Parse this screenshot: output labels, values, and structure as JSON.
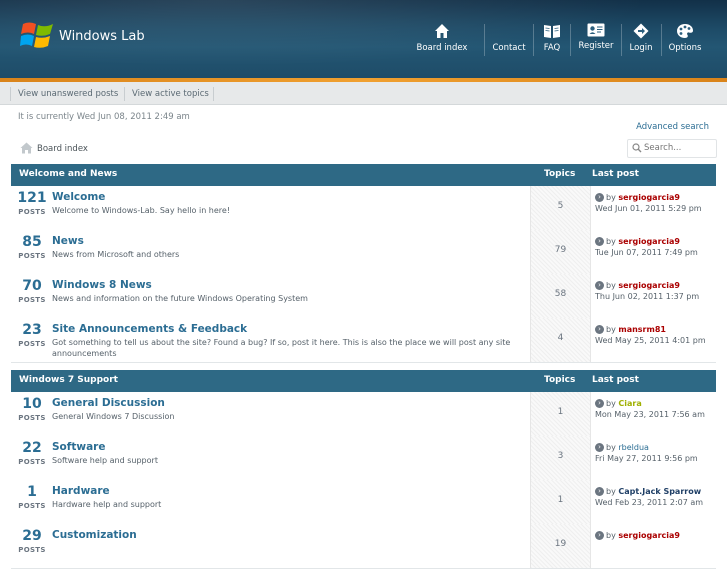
{
  "header": {
    "logo_text": "Windows Lab",
    "nav": [
      {
        "label": "Board index",
        "icon": "home-icon"
      },
      {
        "label": "Contact",
        "icon": "contact-icon"
      },
      {
        "label": "FAQ",
        "icon": "book-icon"
      },
      {
        "label": "Register",
        "icon": "register-icon"
      },
      {
        "label": "Login",
        "icon": "login-icon"
      },
      {
        "label": "Options",
        "icon": "palette-icon"
      }
    ],
    "colors": {
      "header": "#1d4a66",
      "accent": "#f0a030"
    }
  },
  "subnav": {
    "unanswered": "View unanswered posts",
    "active": "View active topics"
  },
  "meta": {
    "date_line": "It is currently Wed Jun 08, 2011 2:49 am",
    "advanced_search": "Advanced search",
    "breadcrumb": "Board index",
    "search_placeholder": "Search..."
  },
  "categories": [
    {
      "title": "Welcome and News",
      "topics_header": "Topics",
      "last_post_header": "Last post",
      "forums": [
        {
          "posts": "121",
          "posts_label": "POSTS",
          "name": "Welcome",
          "desc": "Welcome to Windows-Lab. Say hello in here!",
          "topics": "5",
          "by": "by",
          "user": "sergiogarcia9",
          "user_color": "#aa0000",
          "date": "Wed Jun 01, 2011 5:29 pm"
        },
        {
          "posts": "85",
          "posts_label": "POSTS",
          "name": "News",
          "desc": "News from Microsoft and others",
          "topics": "79",
          "by": "by",
          "user": "sergiogarcia9",
          "user_color": "#aa0000",
          "date": "Tue Jun 07, 2011 7:49 pm"
        },
        {
          "posts": "70",
          "posts_label": "POSTS",
          "name": "Windows 8 News",
          "desc": "News and information on the future Windows Operating System",
          "topics": "58",
          "by": "by",
          "user": "sergiogarcia9",
          "user_color": "#aa0000",
          "date": "Thu Jun 02, 2011 1:37 pm"
        },
        {
          "posts": "23",
          "posts_label": "POSTS",
          "name": "Site Announcements & Feedback",
          "desc": "Got something to tell us about the site? Found a bug? If so, post it here. This is also the place we will post any site announcements",
          "topics": "4",
          "by": "by",
          "user": "mansrm81",
          "user_color": "#aa0000",
          "date": "Wed May 25, 2011 4:01 pm"
        }
      ]
    },
    {
      "title": "Windows 7 Support",
      "topics_header": "Topics",
      "last_post_header": "Last post",
      "forums": [
        {
          "posts": "10",
          "posts_label": "POSTS",
          "name": "General Discussion",
          "desc": "General Windows 7 Discussion",
          "topics": "1",
          "by": "by",
          "user": "Ciara",
          "user_color": "#9fb000",
          "date": "Mon May 23, 2011 7:56 am"
        },
        {
          "posts": "22",
          "posts_label": "POSTS",
          "name": "Software",
          "desc": "Software help and support",
          "topics": "3",
          "by": "by",
          "user": "rbeldua",
          "user_color": "#2b6d93",
          "date": "Fri May 27, 2011 9:56 pm"
        },
        {
          "posts": "1",
          "posts_label": "POSTS",
          "name": "Hardware",
          "desc": "Hardware help and support",
          "topics": "1",
          "by": "by",
          "user": "Capt.Jack Sparrow",
          "user_color": "#1f3f66",
          "date": "Wed Feb 23, 2011 2:07 am"
        },
        {
          "posts": "29",
          "posts_label": "POSTS",
          "name": "Customization",
          "desc": "",
          "topics": "19",
          "by": "by",
          "user": "sergiogarcia9",
          "user_color": "#aa0000",
          "date": ""
        }
      ]
    }
  ]
}
